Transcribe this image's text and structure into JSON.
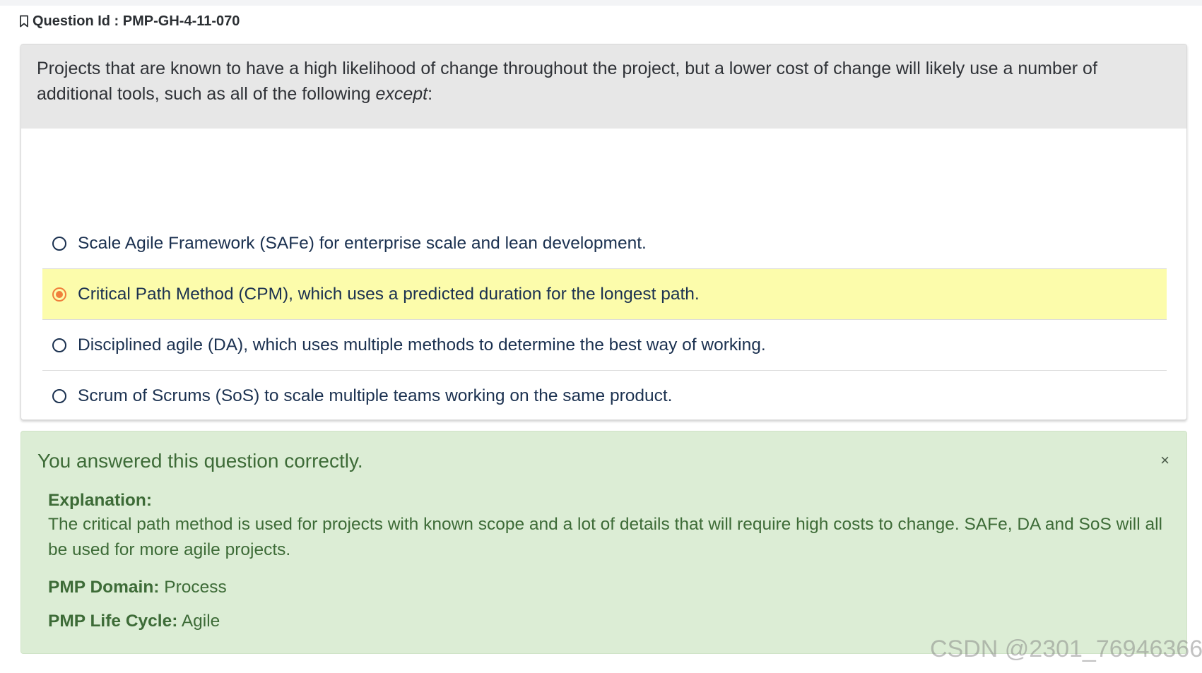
{
  "question_header": {
    "icon": "bookmark-icon",
    "label": "Question Id : ",
    "id": "PMP-GH-4-11-070"
  },
  "question": {
    "text_before": "Projects that are known to have a high likelihood of change throughout the project, but a lower cost of change will likely use a number of additional tools, such as all of the following ",
    "text_emphasis": "except",
    "text_after": ":"
  },
  "options": [
    {
      "label": "Scale Agile Framework (SAFe) for enterprise scale and lean development.",
      "selected": false
    },
    {
      "label": "Critical Path Method (CPM), which uses a predicted duration for the longest path.",
      "selected": true
    },
    {
      "label": "Disciplined agile (DA), which uses multiple methods to determine the best way of working.",
      "selected": false
    },
    {
      "label": "Scrum of Scrums (SoS) to scale multiple teams working on the same product.",
      "selected": false
    }
  ],
  "feedback": {
    "title": "You answered this question correctly.",
    "close_symbol": "×",
    "explanation_label": "Explanation:",
    "explanation_text": "The critical path method is used for projects with known scope and a lot of details that will require high costs to change.  SAFe, DA and SoS will all be used for more agile projects.",
    "domain_label": "PMP Domain:",
    "domain_value": "Process",
    "lifecycle_label": "PMP Life Cycle:",
    "lifecycle_value": "Agile"
  },
  "watermark": "CSDN @2301_76946366",
  "colors": {
    "selected_bg": "#fcfcab",
    "radio_selected": "#f07f3c",
    "feedback_bg": "#dcedd5",
    "feedback_text": "#3d6b37"
  }
}
